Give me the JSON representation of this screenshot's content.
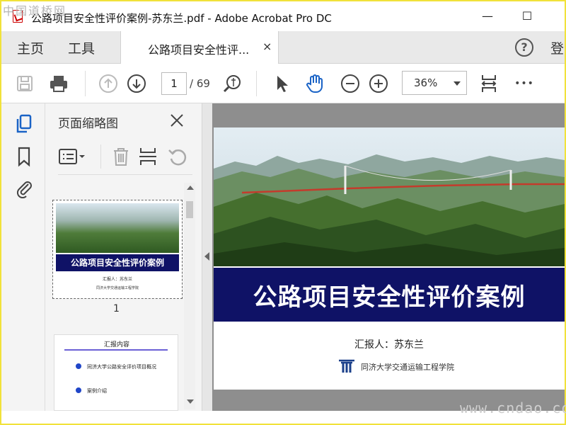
{
  "watermark_top": "中国道桥网",
  "watermark_bottom": "www.cndao.com",
  "window": {
    "title": "公路项目安全性评价案例-苏东兰.pdf - Adobe Acrobat Pro DC",
    "minimize_glyph": "—",
    "maximize_glyph": "☐"
  },
  "menu": {
    "home": "主页",
    "tools": "工具",
    "tab_label": "公路项目安全性评...",
    "tab_close": "×",
    "help": "?",
    "signin": "登"
  },
  "toolbar": {
    "page_current": "1",
    "page_total": "/ 69",
    "zoom": "36%",
    "more": "•••"
  },
  "thumbnails_panel": {
    "title": "页面缩略图",
    "page1_number": "1",
    "page1_title": "公路项目安全性评价案例",
    "page1_reporter": "汇报人：苏东兰",
    "page1_institute": "同济大学交通运输工程学院",
    "page2_title": "汇报内容",
    "page2_items": [
      "同济大学公路安全评价项目概况",
      "案例介绍"
    ]
  },
  "slide": {
    "title": "公路项目安全性评价案例",
    "reporter": "汇报人：苏东兰",
    "institute": "同济大学交通运输工程学院"
  },
  "colors": {
    "title_band": "#0f1266",
    "accent_blue": "#1a63c6",
    "frame": "#f1e23a"
  }
}
